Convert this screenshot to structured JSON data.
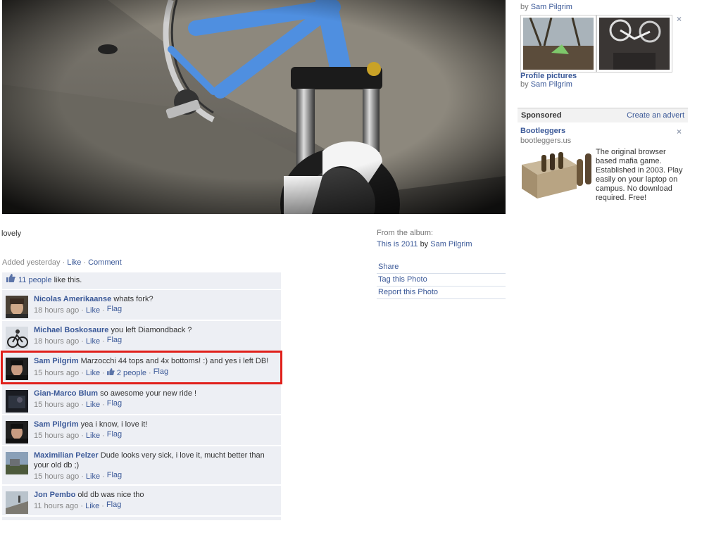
{
  "photo": {
    "caption": "lovely"
  },
  "meta": {
    "added": "Added yesterday",
    "like": "Like",
    "comment": "Comment"
  },
  "likes": {
    "count_link": "11 people",
    "suffix": " like this."
  },
  "comments": [
    {
      "author": "Nicolas Amerikaanse",
      "text": "whats fork?",
      "time": "18 hours ago",
      "like": "Like",
      "flag": "Flag",
      "avatar": "face"
    },
    {
      "author": "Michael Boskosaure",
      "text": "you left Diamondback ?",
      "time": "18 hours ago",
      "like": "Like",
      "flag": "Flag",
      "avatar": "bike"
    },
    {
      "author": "Sam Pilgrim",
      "text": "Marzocchi 44 tops and 4x bottoms! :) and yes i left DB!",
      "time": "15 hours ago",
      "like": "Like",
      "likes_people": "2 people",
      "flag": "Flag",
      "avatar": "face2",
      "highlighted": true
    },
    {
      "author": "Gian-Marco Blum",
      "text": "so awesome your new ride !",
      "time": "15 hours ago",
      "like": "Like",
      "flag": "Flag",
      "avatar": "dark"
    },
    {
      "author": "Sam Pilgrim",
      "text": "yea i know, i love it!",
      "time": "15 hours ago",
      "like": "Like",
      "flag": "Flag",
      "avatar": "face2"
    },
    {
      "author": "Maximilian Pelzer",
      "text": "Dude looks very sick, i love it, mucht better than your old db ;)",
      "time": "15 hours ago",
      "like": "Like",
      "flag": "Flag",
      "avatar": "landscape"
    },
    {
      "author": "Jon Pembo",
      "text": "old db was nice tho",
      "time": "11 hours ago",
      "like": "Like",
      "flag": "Flag",
      "avatar": "ramp"
    }
  ],
  "album": {
    "from_label": "From the album:",
    "album_name": "This is 2011",
    "by": "by",
    "owner": "Sam Pilgrim",
    "actions": [
      "Share",
      "Tag this Photo",
      "Report this Photo"
    ]
  },
  "sidebar": {
    "top_by": "by",
    "top_owner": "Sam Pilgrim",
    "profile_pictures": "Profile pictures",
    "profile_by": "by",
    "profile_owner": "Sam Pilgrim",
    "close_symbol": "×",
    "sponsored_label": "Sponsored",
    "create_advert": "Create an advert",
    "ad_title": "Bootleggers",
    "ad_domain": "bootleggers.us",
    "ad_body": "The original browser based mafia game. Established in 2003. Play easily on your laptop on campus. No download required. Free!"
  },
  "colors": {
    "link": "#3b5998",
    "highlight": "#e0201b",
    "comment_bg": "#edeff4"
  }
}
